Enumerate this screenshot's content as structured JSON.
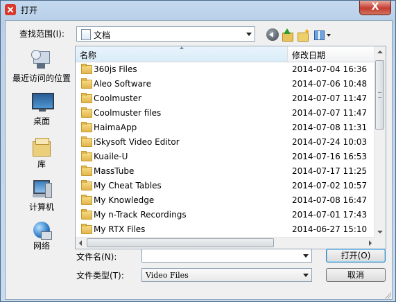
{
  "window": {
    "title": "打开",
    "close_label": "X"
  },
  "toolbar": {
    "look_in_label": "查找范围(I):",
    "look_in_value": "文档",
    "icons": [
      "back-icon",
      "up-folder-icon",
      "new-folder-icon",
      "view-menu-icon"
    ]
  },
  "places": [
    {
      "label": "最近访问的位置",
      "icon": "recent-places-icon"
    },
    {
      "label": "桌面",
      "icon": "desktop-icon"
    },
    {
      "label": "库",
      "icon": "libraries-icon"
    },
    {
      "label": "计算机",
      "icon": "computer-icon"
    },
    {
      "label": "网络",
      "icon": "network-icon"
    }
  ],
  "file_list": {
    "columns": [
      "名称",
      "修改日期"
    ],
    "rows": [
      {
        "name": "360js Files",
        "date": "2014-07-04 16:36"
      },
      {
        "name": "Aleo Software",
        "date": "2014-07-06 10:48"
      },
      {
        "name": "Coolmuster",
        "date": "2014-07-07 11:47"
      },
      {
        "name": "Coolmuster files",
        "date": "2014-07-07 11:47"
      },
      {
        "name": "HaimaApp",
        "date": "2014-07-08 11:31"
      },
      {
        "name": "iSkysoft Video Editor",
        "date": "2014-07-24 10:03"
      },
      {
        "name": "Kuaile-U",
        "date": "2014-07-16 16:53"
      },
      {
        "name": "MassTube",
        "date": "2014-07-17 11:25"
      },
      {
        "name": "My Cheat Tables",
        "date": "2014-07-02 10:57"
      },
      {
        "name": "My Knowledge",
        "date": "2014-07-08 16:47"
      },
      {
        "name": "My n-Track Recordings",
        "date": "2014-07-01 17:43"
      },
      {
        "name": "My RTX Files",
        "date": "2014-06-27 15:10"
      }
    ]
  },
  "form": {
    "filename_label": "文件名(N):",
    "filename_value": "",
    "filetype_label": "文件类型(T):",
    "filetype_value": "Video Files",
    "open_label": "打开(O)",
    "cancel_label": "取消"
  },
  "colors": {
    "title_gradient": "#c4d9ef",
    "close_button": "#c7443a",
    "folder": "#e2b54d",
    "default_button_border": "#3c7fb1"
  }
}
